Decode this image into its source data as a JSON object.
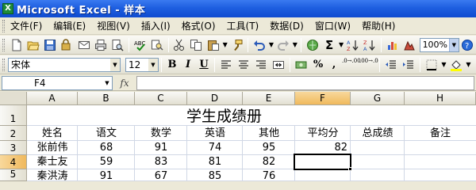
{
  "window": {
    "title": "Microsoft Excel - 样本",
    "app_icon": "X"
  },
  "menu": [
    "文件(F)",
    "编辑(E)",
    "视图(V)",
    "插入(I)",
    "格式(O)",
    "工具(T)",
    "数据(D)",
    "窗口(W)",
    "帮助(H)"
  ],
  "toolbar": {
    "zoom": "100%",
    "sigma": "Σ"
  },
  "format_bar": {
    "font_name": "宋体",
    "font_size": "12",
    "bold": "B",
    "italic": "I",
    "underline": "U",
    "percent": "%",
    "comma": ",",
    "inc_dec": ".0→.00",
    "dec_dec": ".00→.0"
  },
  "formula_bar": {
    "name_box": "F4",
    "fx": "fx",
    "formula": ""
  },
  "grid": {
    "columns": [
      "A",
      "B",
      "C",
      "D",
      "E",
      "F",
      "G",
      "H"
    ],
    "rows": [
      "1",
      "2",
      "3",
      "4",
      "5"
    ],
    "selected_column": "F",
    "selected_row": "4",
    "sheet_title": "学生成绩册",
    "headers": [
      "姓名",
      "语文",
      "数学",
      "英语",
      "其他",
      "平均分",
      "总成绩",
      "备注"
    ],
    "data": [
      [
        "张前伟",
        "68",
        "91",
        "74",
        "95",
        "82",
        "",
        ""
      ],
      [
        "秦士友",
        "59",
        "83",
        "81",
        "82",
        "",
        "",
        ""
      ],
      [
        "秦洪涛",
        "91",
        "67",
        "85",
        "76",
        "",
        "",
        ""
      ]
    ]
  },
  "colors": {
    "title_bar": "#1e5fe0",
    "selected_header": "#f0b95c",
    "grid_line": "#d0d7e5"
  }
}
